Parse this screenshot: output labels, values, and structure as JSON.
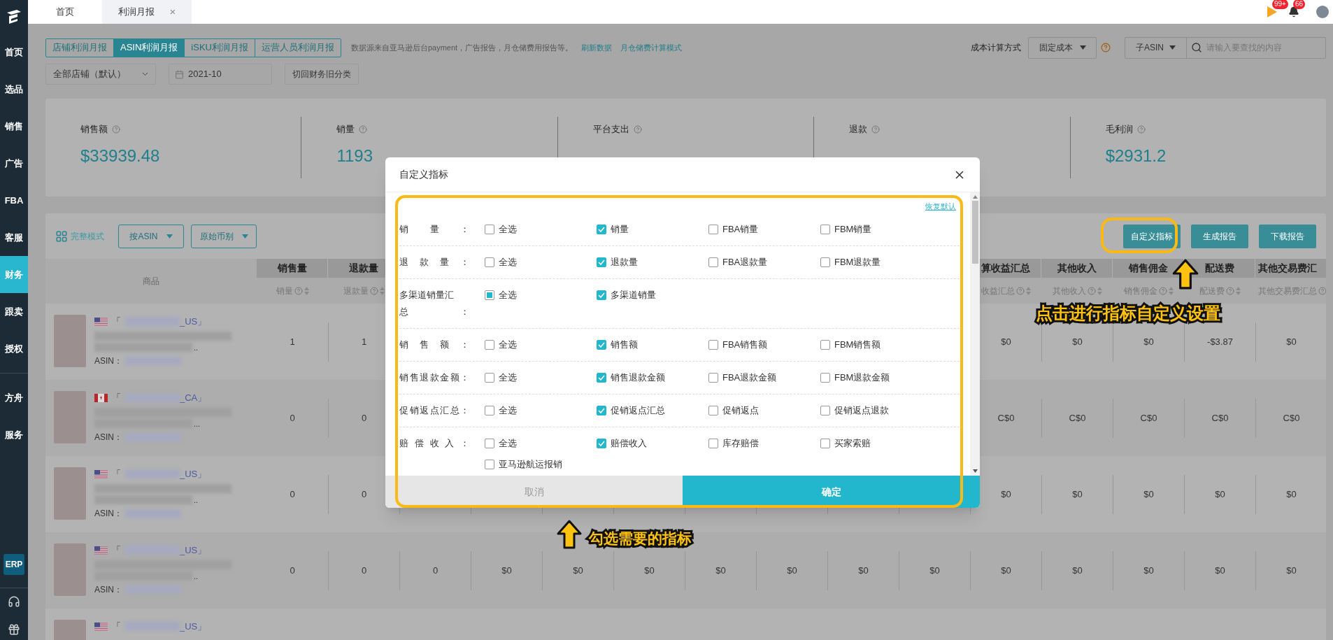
{
  "sidebar": {
    "items": [
      {
        "label": "首页",
        "selected": false
      },
      {
        "label": "选品",
        "selected": false
      },
      {
        "label": "销售",
        "selected": false
      },
      {
        "label": "广告",
        "selected": false
      },
      {
        "label": "FBA",
        "selected": false
      },
      {
        "label": "客服",
        "selected": false
      },
      {
        "label": "财务",
        "selected": true
      },
      {
        "label": "跟卖",
        "selected": false
      },
      {
        "label": "授权",
        "selected": false
      }
    ],
    "extra_items": [
      {
        "label": "方舟",
        "selected": false
      },
      {
        "label": "服务",
        "selected": false
      }
    ],
    "erp_badge": "ERP"
  },
  "top_tabs": [
    {
      "label": "首页",
      "selected": false
    },
    {
      "label": "利润月报",
      "selected": true,
      "close": "×"
    }
  ],
  "notifications": [
    {
      "kind": "flag",
      "badge": "99+"
    },
    {
      "kind": "bell",
      "badge": "66"
    }
  ],
  "report_tabs": [
    {
      "label": "店铺利润月报",
      "selected": false
    },
    {
      "label": "ASIN利润月报",
      "selected": true
    },
    {
      "label": "iSKU利润月报",
      "selected": false
    },
    {
      "label": "运营人员利润月报",
      "selected": false
    }
  ],
  "data_source_note": "数据源来自亚马逊后台payment，广告报告，月仓储费用报告等。",
  "links": [
    "刷新数据",
    "月仓储费计算模式"
  ],
  "store_select": "全部店铺（默认）",
  "month_field": "2021-10",
  "legacy_button": "切回财务旧分类",
  "cost_method": {
    "label": "成本计算方式",
    "value": "固定成本"
  },
  "search": {
    "scope": "子ASIN",
    "placeholder": "请输入要查找的内容"
  },
  "stats": [
    {
      "label": "销售额",
      "value": "$33939.48"
    },
    {
      "label": "销量",
      "value": "1193"
    },
    {
      "label": "平台支出"
    },
    {
      "label": "退款"
    },
    {
      "label": "毛利润",
      "value": "$2931.2"
    }
  ],
  "toolbar": {
    "view_mode": "完整模式",
    "group_by": "按ASIN",
    "currency": "原始币别",
    "buttons": [
      "自定义指标",
      "生成报告",
      "下载报告"
    ]
  },
  "table": {
    "product_column": "商品",
    "columns": [
      {
        "title": "销售量",
        "subtitle": "销量"
      },
      {
        "title": "退款量",
        "subtitle": "退款量"
      },
      null,
      null,
      null,
      null,
      null,
      null,
      null,
      null,
      {
        "title": "算收益汇总",
        "subtitle": "收益汇总"
      },
      {
        "title": "其他收入",
        "subtitle": "其他收入"
      },
      {
        "title": "销售佣金",
        "subtitle": "销售佣金"
      },
      {
        "title": "配送费",
        "subtitle": "配送费"
      },
      {
        "title": "其他交易费汇",
        "subtitle": "其他交易费汇总"
      }
    ],
    "rows": [
      {
        "flag": {
          "kind": "us"
        },
        "store_open": "「",
        "store": "_US」",
        "ellipsis": "..",
        "asin_label": "ASIN：",
        "cells": [
          "1",
          "1",
          null,
          null,
          null,
          null,
          null,
          null,
          null,
          null,
          "$0",
          "$0",
          "$0",
          "-$3.87",
          "$0"
        ]
      },
      {
        "flag": {
          "kind": "ca"
        },
        "store_open": "「",
        "store": "_CA」",
        "ellipsis": "...",
        "asin_label": "ASIN：",
        "cells": [
          "0",
          "0",
          null,
          null,
          null,
          null,
          null,
          null,
          null,
          null,
          "C$0",
          "C$0",
          "C$0",
          "C$0",
          "C$0"
        ]
      },
      {
        "flag": {
          "kind": "us"
        },
        "store_open": "「",
        "store": "_US」",
        "ellipsis": "..",
        "asin_label": "ASIN：",
        "cells": [
          "0",
          "0",
          null,
          null,
          null,
          null,
          null,
          null,
          null,
          null,
          "$0",
          "$0",
          "$0",
          "$0",
          "$0"
        ]
      },
      {
        "flag": {
          "kind": "us"
        },
        "store_open": "「",
        "store": "_US」",
        "ellipsis": "..",
        "asin_label": "ASIN：",
        "cells": [
          "0",
          "0",
          "0",
          "$0",
          "$0",
          "$0",
          "$0",
          "$0",
          "$0",
          "$0",
          "$0",
          "$0",
          "$0",
          "$0",
          "$0"
        ]
      },
      {
        "flag": {
          "kind": "us"
        },
        "store_open": "「",
        "store": "_US」"
      }
    ]
  },
  "dialog": {
    "title": "自定义指标",
    "reset_link": "恢复默认",
    "groups": [
      {
        "label": "销量：",
        "options": [
          {
            "label": "全选",
            "checked": false,
            "indeterminate": false
          },
          {
            "label": "销量",
            "checked": true,
            "indeterminate": false
          },
          {
            "label": "FBA销量",
            "checked": false,
            "indeterminate": false
          },
          {
            "label": "FBM销量",
            "checked": false,
            "indeterminate": false
          }
        ]
      },
      {
        "label": "退款量：",
        "options": [
          {
            "label": "全选",
            "checked": false,
            "indeterminate": false
          },
          {
            "label": "退款量",
            "checked": true,
            "indeterminate": false
          },
          {
            "label": "FBA退款量",
            "checked": false,
            "indeterminate": false
          },
          {
            "label": "FBM退款量",
            "checked": false,
            "indeterminate": false
          }
        ]
      },
      {
        "label": "多渠道销量汇总：",
        "options": [
          {
            "label": "全选",
            "checked": false,
            "indeterminate": true
          },
          {
            "label": "多渠道销量",
            "checked": true,
            "indeterminate": false
          }
        ]
      },
      {
        "label": "销售额：",
        "options": [
          {
            "label": "全选",
            "checked": false,
            "indeterminate": false
          },
          {
            "label": "销售额",
            "checked": true,
            "indeterminate": false
          },
          {
            "label": "FBA销售额",
            "checked": false,
            "indeterminate": false
          },
          {
            "label": "FBM销售额",
            "checked": false,
            "indeterminate": false
          }
        ]
      },
      {
        "label": "销售退款金额：",
        "options": [
          {
            "label": "全选",
            "checked": false,
            "indeterminate": false
          },
          {
            "label": "销售退款金额",
            "checked": true,
            "indeterminate": false
          },
          {
            "label": "FBA退款金额",
            "checked": false,
            "indeterminate": false
          },
          {
            "label": "FBM退款金额",
            "checked": false,
            "indeterminate": false
          }
        ]
      },
      {
        "label": "促销返点汇总：",
        "options": [
          {
            "label": "全选",
            "checked": false,
            "indeterminate": false
          },
          {
            "label": "促销返点汇总",
            "checked": true,
            "indeterminate": false
          },
          {
            "label": "促销返点",
            "checked": false,
            "indeterminate": false
          },
          {
            "label": "促销返点退款",
            "checked": false,
            "indeterminate": false
          }
        ]
      },
      {
        "label": "赔偿收入：",
        "options": [
          {
            "label": "全选",
            "checked": false,
            "indeterminate": false
          },
          {
            "label": "赔偿收入",
            "checked": true,
            "indeterminate": false
          },
          {
            "label": "库存赔偿",
            "checked": false,
            "indeterminate": false
          },
          {
            "label": "买家索赔",
            "checked": false,
            "indeterminate": false
          },
          {
            "label": "亚马逊航运报销",
            "checked": false,
            "indeterminate": false
          }
        ]
      }
    ],
    "cancel": "取消",
    "confirm": "确定"
  },
  "annotations": {
    "button_hint": "点击进行指标自定义设置",
    "dialog_hint": "勾选需要的指标"
  }
}
